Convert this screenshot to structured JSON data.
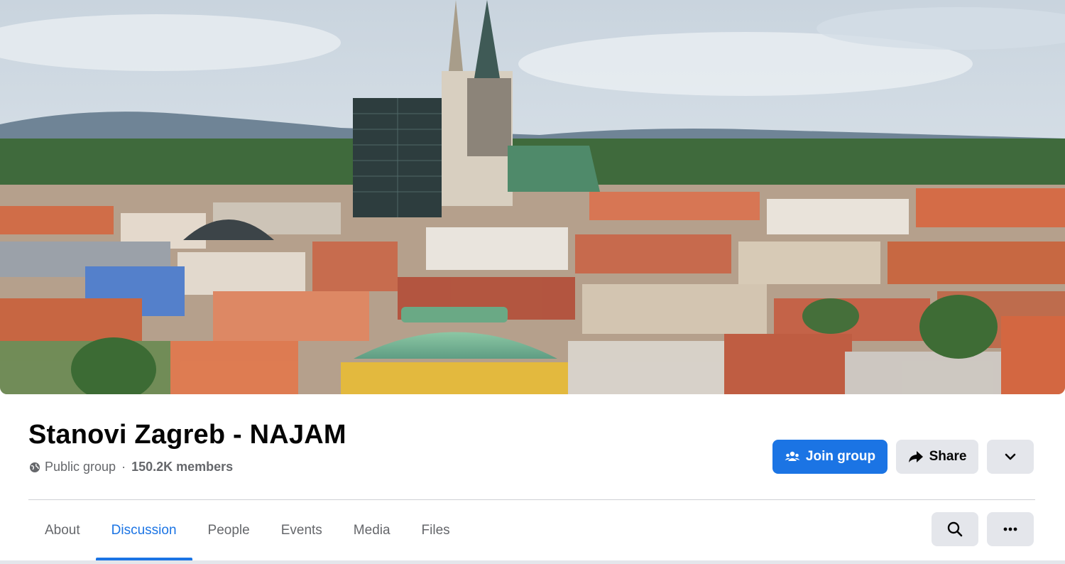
{
  "group": {
    "name": "Stanovi Zagreb - NAJAM",
    "privacy": "Public group",
    "separator": "·",
    "members": "150.2K members"
  },
  "actions": {
    "join_label": "Join group",
    "share_label": "Share",
    "more_icon": "chevron-down-icon"
  },
  "tabs": [
    {
      "label": "About",
      "active": false
    },
    {
      "label": "Discussion",
      "active": true
    },
    {
      "label": "People",
      "active": false
    },
    {
      "label": "Events",
      "active": false
    },
    {
      "label": "Media",
      "active": false
    },
    {
      "label": "Files",
      "active": false
    }
  ],
  "tab_actions": {
    "search_icon": "search-icon",
    "more_icon": "ellipsis-icon"
  },
  "colors": {
    "primary": "#1b74e4",
    "secondary_bg": "#e4e6eb",
    "text_secondary": "#65676b"
  }
}
